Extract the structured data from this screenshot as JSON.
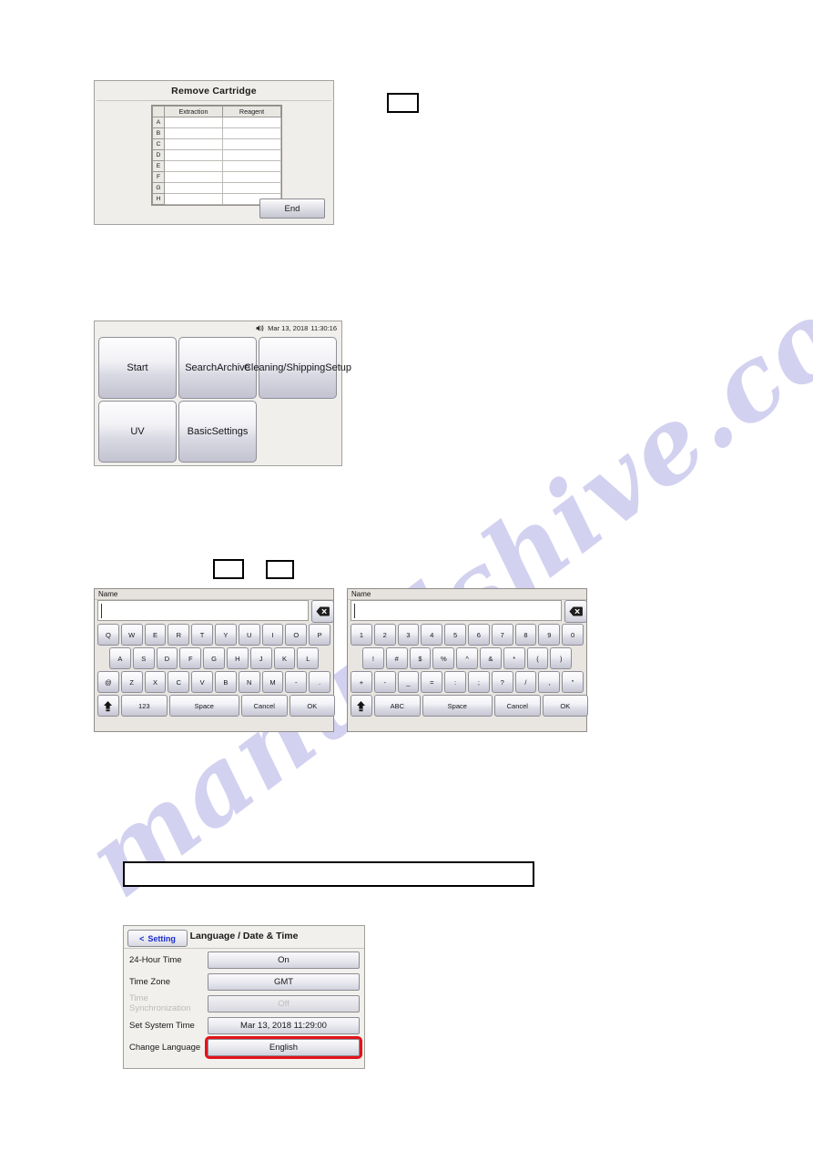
{
  "document": {
    "page_background": "#ffffff",
    "watermark_text": "manualshive.com"
  },
  "figures": {
    "remove_cartridge": {
      "title": "Remove Cartridge",
      "columns": [
        "Extraction",
        "Reagent"
      ],
      "rows": [
        "A",
        "B",
        "C",
        "D",
        "E",
        "F",
        "G",
        "H"
      ],
      "cells": [
        [
          "",
          ""
        ],
        [
          "",
          ""
        ],
        [
          "",
          ""
        ],
        [
          "",
          ""
        ],
        [
          "",
          ""
        ],
        [
          "",
          ""
        ],
        [
          "",
          ""
        ],
        [
          "",
          ""
        ]
      ],
      "end_button": "End"
    },
    "main_menu": {
      "status_icon": "speaker-icon",
      "status_date": "Mar 13, 2018",
      "status_time": "11:30:16",
      "buttons": [
        {
          "label": "Start",
          "empty": false
        },
        {
          "label": "Search\nArchive",
          "empty": false
        },
        {
          "label": "Cleaning/\nShipping\nSetup",
          "empty": false
        },
        {
          "label": "UV",
          "empty": false
        },
        {
          "label": "Basic\nSettings",
          "empty": false
        },
        {
          "label": "",
          "empty": true
        }
      ]
    },
    "keyboard_alpha": {
      "field_label": "Name",
      "field_value": "",
      "backspace_icon": "backspace-icon",
      "rows": [
        [
          "Q",
          "W",
          "E",
          "R",
          "T",
          "Y",
          "U",
          "I",
          "O",
          "P"
        ],
        [
          "A",
          "S",
          "D",
          "F",
          "G",
          "H",
          "J",
          "K",
          "L"
        ],
        [
          "@",
          "Z",
          "X",
          "C",
          "V",
          "B",
          "N",
          "M",
          "-",
          "."
        ]
      ],
      "shift_icon": "shift-icon",
      "mode_key": "123",
      "space_key": "Space",
      "cancel_key": "Cancel",
      "ok_key": "OK"
    },
    "keyboard_numeric": {
      "field_label": "Name",
      "field_value": "",
      "backspace_icon": "backspace-icon",
      "rows": [
        [
          "1",
          "2",
          "3",
          "4",
          "5",
          "6",
          "7",
          "8",
          "9",
          "0"
        ],
        [
          "!",
          "#",
          "$",
          "%",
          "^",
          "&",
          "*",
          "(",
          ")"
        ],
        [
          "+",
          "-",
          "_",
          "=",
          ":",
          ";",
          "?",
          "/",
          ",",
          "\""
        ]
      ],
      "shift_icon": "shift-icon",
      "mode_key": "ABC",
      "space_key": "Space",
      "cancel_key": "Cancel",
      "ok_key": "OK"
    },
    "language_date_time": {
      "back_label": "Setting",
      "back_chevron": "<",
      "title": "Language / Date & Time",
      "highlight_color": "#e31219",
      "accent_color": "#1c2ecb",
      "rows": [
        {
          "label": "24-Hour Time",
          "value": "On",
          "disabled": false,
          "highlighted": false
        },
        {
          "label": "Time Zone",
          "value": "GMT",
          "disabled": false,
          "highlighted": false
        },
        {
          "label": "Time Synchronization",
          "value": "Off",
          "disabled": true,
          "highlighted": false
        },
        {
          "label": "Set System Time",
          "value": "Mar 13, 2018  11:29:00",
          "disabled": false,
          "highlighted": false
        },
        {
          "label": "Change Language",
          "value": "English",
          "disabled": false,
          "highlighted": true
        }
      ]
    }
  },
  "callouts": [
    {
      "name": "callout-box-1",
      "text": ""
    },
    {
      "name": "callout-box-2",
      "text": ""
    },
    {
      "name": "callout-box-3",
      "text": ""
    },
    {
      "name": "callout-box-wide",
      "text": ""
    }
  ]
}
